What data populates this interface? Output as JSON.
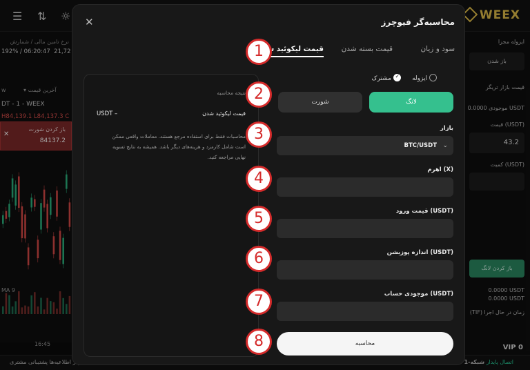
{
  "background": {
    "topbar_icons": [
      "menu-icon",
      "sliders-icon",
      "sun-icon"
    ],
    "brand": "WEEX",
    "left": {
      "funding_label": "نرخ تامین مالی / شمارش",
      "funding_value": "192% / 06:20:47",
      "funding_extra": "21,72",
      "tab_w": "w",
      "ticker": "DT - 1 - WEEX",
      "ohlc": "H84,139.1  L84,137.3  C",
      "open_short_label": "باز کردن شورت",
      "open_short_value": "84137.2",
      "ma_label": "MA 9",
      "time_label": "16:45",
      "last_price_label": "آخرین قیمت"
    },
    "right": {
      "margin_mode": "ایزوله مجزا",
      "open_button": "باز شدن",
      "order_tabs": "قیمت   بازار   تریگر",
      "available": "موجودی  0.0000 USDT",
      "price_label": "قیمت (USDT)",
      "price_value": "43.2",
      "amount_label": "کمیت (USDT)",
      "open_long": "باز کردن لانگ",
      "fee1": "0.0000 USDT",
      "fee2": "0.0000 USDT",
      "tif": "(TIF) زمان در حال اجرا",
      "vip": "VIP 0"
    },
    "bottom_left": "مرکز اطلاعیه‌ها   پشتیبانی مشتری",
    "bottom_right_prefix": "اتصال پایدار",
    "bottom_right_suffix": "شبکه-1"
  },
  "modal": {
    "title": "محاسبه‌گر فیوچرز",
    "tabs": [
      {
        "label": "سود و زیان",
        "active": false
      },
      {
        "label": "قیمت بسته شدن",
        "active": false
      },
      {
        "label": "قیمت لیکوئید شدن",
        "active": true
      }
    ],
    "margin_modes": [
      {
        "label": "ایزوله",
        "selected": false
      },
      {
        "label": "مشترک",
        "selected": true
      }
    ],
    "long_label": "لانگ",
    "short_label": "شورت",
    "market_label": "بازار",
    "market_value": "BTC/USDT",
    "leverage_label": "اهرم (X)",
    "entry_price_label": "قیمت ورود (USDT)",
    "position_size_label": "اندازه پوزیشن (USDT)",
    "balance_label": "موجودی حساب (USDT)",
    "calculate_label": "محاسبه",
    "result": {
      "heading": "نتیجه محاسبه",
      "liq_label": "قیمت لیکوئید شدن",
      "liq_value": "USDT –",
      "note": "محاسبات فقط برای استفاده مرجع هستند. معاملات واقعی ممکن است شامل کارمزد و هزینه‌های دیگر باشد. همیشه به نتایج تسویه نهایی مراجعه کنید."
    }
  },
  "annotations": [
    "1",
    "2",
    "3",
    "4",
    "5",
    "6",
    "7",
    "8"
  ],
  "colors": {
    "long_green": "#35c08e",
    "annotation_red": "#d52b2b",
    "brand_gold": "#e3c04a"
  }
}
